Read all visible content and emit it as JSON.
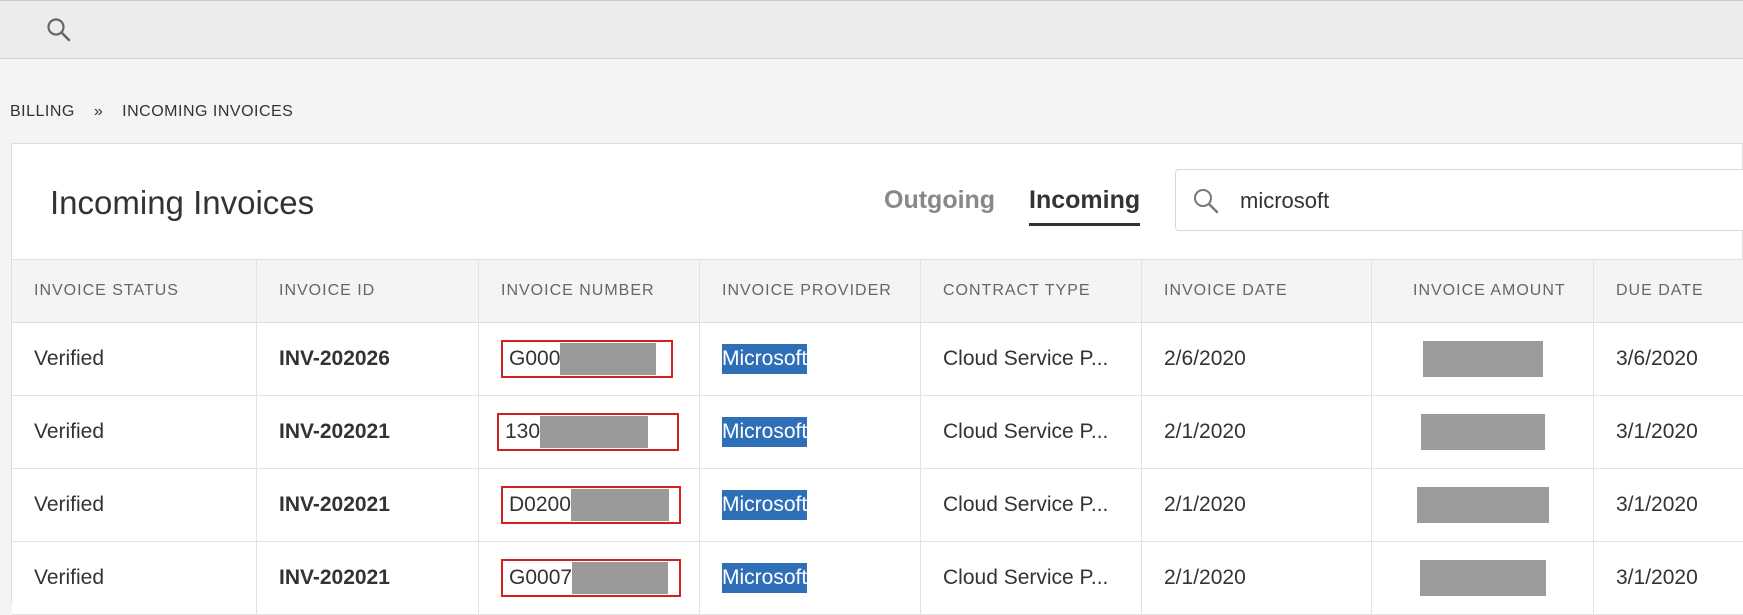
{
  "topbar": {
    "search_icon": "search-icon"
  },
  "breadcrumb": {
    "items": [
      "BILLING",
      "INCOMING INVOICES"
    ],
    "separator": "»"
  },
  "page": {
    "title": "Incoming Invoices",
    "tabs": [
      {
        "label": "Outgoing"
      },
      {
        "label": "Incoming"
      }
    ],
    "active_tab": "Incoming",
    "search": {
      "value": "microsoft",
      "icon": "search-icon"
    }
  },
  "table": {
    "columns": [
      "INVOICE STATUS",
      "INVOICE ID",
      "INVOICE NUMBER",
      "INVOICE PROVIDER",
      "CONTRACT TYPE",
      "INVOICE DATE",
      "INVOICE AMOUNT",
      "DUE DATE"
    ],
    "rows": [
      {
        "status": "Verified",
        "id": "INV-202026",
        "number_prefix": "G000",
        "provider": "Microsoft",
        "contract": "Cloud Service P...",
        "date": "2/6/2020",
        "due": "3/6/2020"
      },
      {
        "status": "Verified",
        "id": "INV-202021",
        "number_prefix": "130",
        "provider": "Microsoft",
        "contract": "Cloud Service P...",
        "date": "2/1/2020",
        "due": "3/1/2020"
      },
      {
        "status": "Verified",
        "id": "INV-202021",
        "number_prefix": "D0200",
        "provider": "Microsoft",
        "contract": "Cloud Service P...",
        "date": "2/1/2020",
        "due": "3/1/2020"
      },
      {
        "status": "Verified",
        "id": "INV-202021",
        "number_prefix": "G0007",
        "provider": "Microsoft",
        "contract": "Cloud Service P...",
        "date": "2/1/2020",
        "due": "3/1/2020"
      }
    ]
  },
  "colors": {
    "highlight": "#2f6fb7",
    "annotation_border": "#d32121",
    "redaction": "#9a9a9a"
  }
}
